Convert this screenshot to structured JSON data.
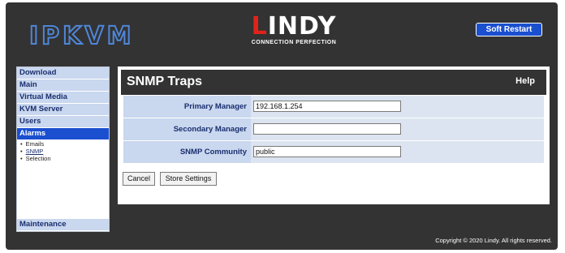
{
  "header": {
    "product_logo": "IPKVM",
    "brand_prefix": "L",
    "brand_rest": "INDY",
    "brand_tagline": "CONNECTION PERFECTION",
    "soft_restart_label": "Soft Restart"
  },
  "sidebar": {
    "items": [
      {
        "label": "Download"
      },
      {
        "label": "Main"
      },
      {
        "label": "Virtual Media"
      },
      {
        "label": "KVM Server"
      },
      {
        "label": "Users"
      },
      {
        "label": "Alarms",
        "active": true
      }
    ],
    "sub_items": [
      {
        "label": "Emails"
      },
      {
        "label": "SNMP",
        "current": true
      },
      {
        "label": "Selection"
      }
    ],
    "maintenance_label": "Maintenance"
  },
  "panel": {
    "title": "SNMP Traps",
    "help_label": "Help",
    "fields": [
      {
        "label": "Primary Manager",
        "value": "192.168.1.254"
      },
      {
        "label": "Secondary Manager",
        "value": ""
      },
      {
        "label": "SNMP Community",
        "value": "public"
      }
    ],
    "cancel_label": "Cancel",
    "store_label": "Store Settings"
  },
  "footer": {
    "copyright": "Copyright © 2020 Lindy. All rights reserved."
  },
  "colors": {
    "background": "#333333",
    "nav_item": "#c9d7ef",
    "active_accent": "#1a4fd0",
    "brand_red": "#e2231a"
  }
}
